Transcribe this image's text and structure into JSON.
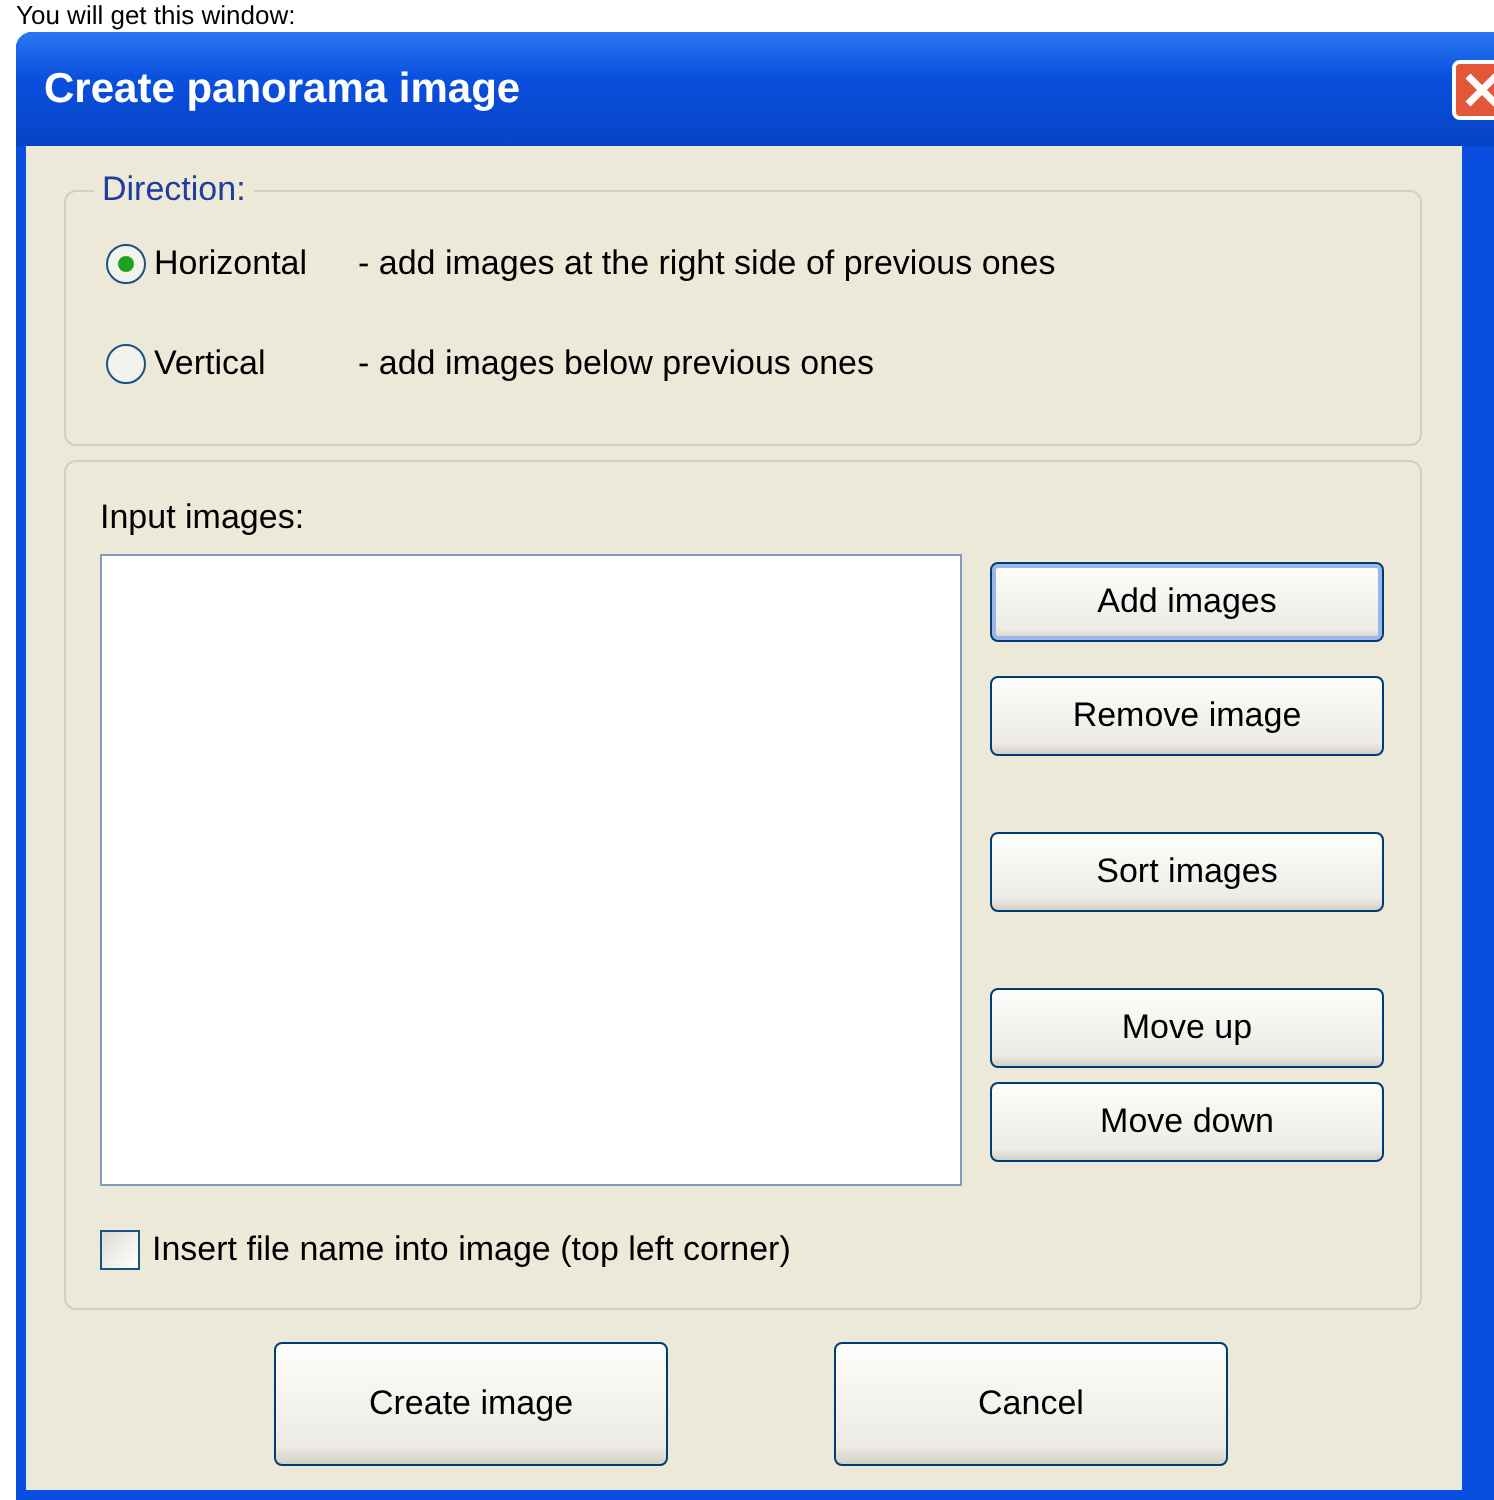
{
  "caption": "You will get this window:",
  "window": {
    "title": "Create panorama image"
  },
  "direction": {
    "label": "Direction:",
    "options": [
      {
        "label": "Horizontal",
        "description": "- add images at the right side of previous ones",
        "selected": true
      },
      {
        "label": "Vertical",
        "description": "- add images below previous ones",
        "selected": false
      }
    ]
  },
  "input_images": {
    "label": "Input images:",
    "buttons": [
      {
        "label": "Add images",
        "focused": true
      },
      {
        "label": "Remove image",
        "focused": false
      },
      {
        "label": "Sort images",
        "focused": false
      },
      {
        "label": "Move up",
        "focused": false
      },
      {
        "label": "Move down",
        "focused": false
      }
    ],
    "insert_file_name": {
      "label": "Insert file name into image (top left corner)",
      "checked": false
    }
  },
  "buttons": [
    "Create image",
    "Cancel"
  ]
}
